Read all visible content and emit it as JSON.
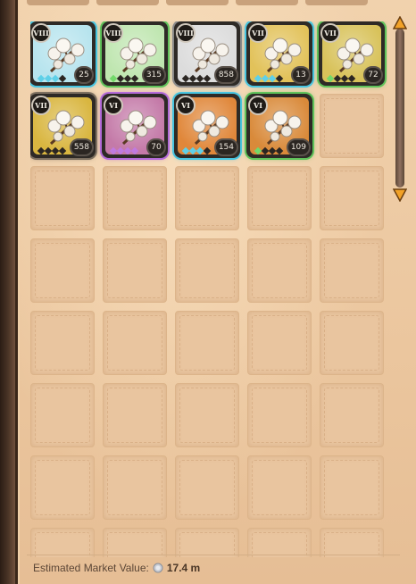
{
  "inventory": {
    "items": [
      {
        "tier": "VIII",
        "quantity": "25",
        "rarity": "uncommon",
        "pips": 3,
        "bg": "#b7e4ee",
        "frame": "#47c4e0",
        "pip_color": "#5fd0e8"
      },
      {
        "tier": "VIII",
        "quantity": "315",
        "rarity": "common",
        "pips": 1,
        "bg": "#bfe6b0",
        "frame": "#5fc25a",
        "pip_color": "#72d86a"
      },
      {
        "tier": "VIII",
        "quantity": "858",
        "rarity": "normal",
        "pips": 0,
        "bg": "#dcdcdc",
        "frame": "#8a8a8a",
        "pip_color": "#bbbbbb"
      },
      {
        "tier": "VII",
        "quantity": "13",
        "rarity": "uncommon",
        "pips": 3,
        "bg": "#e2c25a",
        "frame": "#47c4e0",
        "pip_color": "#5fd0e8"
      },
      {
        "tier": "VII",
        "quantity": "72",
        "rarity": "common",
        "pips": 1,
        "bg": "#d8c25a",
        "frame": "#5fc25a",
        "pip_color": "#72d86a"
      },
      {
        "tier": "VII",
        "quantity": "558",
        "rarity": "normal",
        "pips": 0,
        "bg": "#d9b640",
        "frame": "#7d7060",
        "pip_color": "#bbbbbb"
      },
      {
        "tier": "VI",
        "quantity": "70",
        "rarity": "rare",
        "pips": 4,
        "bg": "#c47aa8",
        "frame": "#b36ad8",
        "pip_color": "#c07ae0"
      },
      {
        "tier": "VI",
        "quantity": "154",
        "rarity": "uncommon",
        "pips": 3,
        "bg": "#e0873a",
        "frame": "#47c4e0",
        "pip_color": "#5fd0e8"
      },
      {
        "tier": "VI",
        "quantity": "109",
        "rarity": "common",
        "pips": 1,
        "bg": "#d98a3a",
        "frame": "#5fc25a",
        "pip_color": "#72d86a"
      }
    ]
  },
  "footer": {
    "label": "Estimated Market Value:",
    "value": "17.4 m"
  },
  "icons": {
    "scroll_up": "arrow-up-icon",
    "scroll_down": "arrow-down-icon",
    "currency": "silver-coin-icon",
    "item": "cotton-icon"
  }
}
